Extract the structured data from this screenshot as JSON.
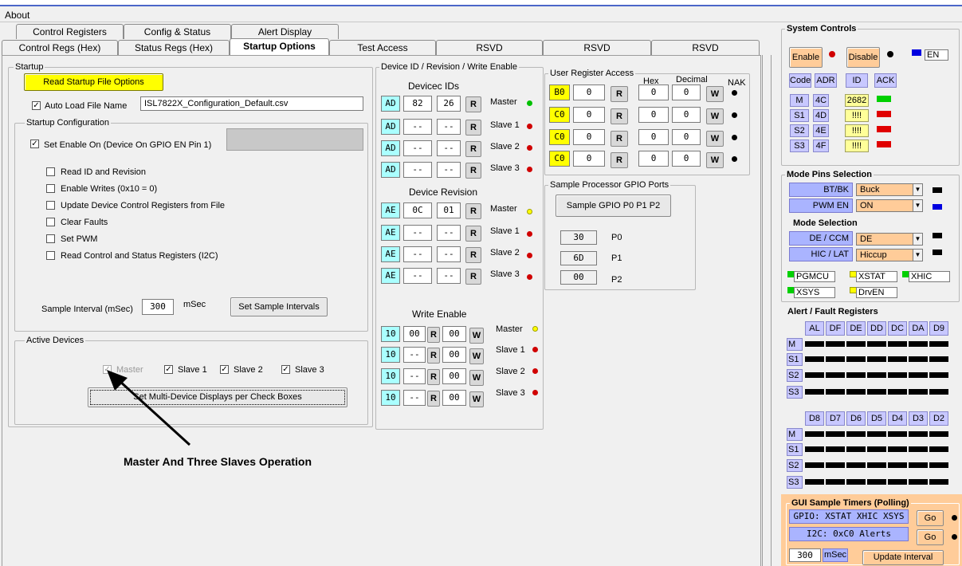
{
  "menu": {
    "about": "About"
  },
  "tabs_row1": [
    "Control Registers",
    "Config & Status",
    "Alert Display"
  ],
  "tabs_row2": [
    "Control Regs (Hex)",
    "Status Regs (Hex)",
    "Startup Options",
    "Test Access",
    "RSVD",
    "RSVD",
    "RSVD"
  ],
  "startup": {
    "title": "Startup",
    "read_btn": "Read Startup File Options",
    "auto_load": "Auto Load File Name",
    "file_name": "ISL7822X_Configuration_Default.csv",
    "config_title": "Startup Configuration",
    "set_enable": "Set Enable On (Device On GPIO  EN Pin 1)",
    "options": [
      "Read ID and Revision",
      "Enable Writes (0x10 = 0)",
      "Update Device Control Registers from File",
      "Clear Faults",
      "Set PWM",
      "Read Control and Status Registers (I2C)"
    ],
    "sample_label": "Sample Interval (mSec)",
    "sample_value": "300",
    "msec": "mSec",
    "set_sample_btn": "Set Sample Intervals",
    "active_title": "Active Devices",
    "active": [
      "Master",
      "Slave 1",
      "Slave 2",
      "Slave 3"
    ],
    "multi_btn": "Set Multi-Device Displays per Check Boxes"
  },
  "annotation": "Master And Three Slaves Operation",
  "device": {
    "title": "Device ID / Revision / Write Enable",
    "ids_title": "Devicec IDs",
    "rev_title": "Device Revision",
    "we_title": "Write Enable",
    "labels": [
      "Master",
      "Slave 1",
      "Slave 2",
      "Slave 3"
    ],
    "ids": [
      [
        "AD",
        "82",
        "26"
      ],
      [
        "AD",
        "--",
        "--"
      ],
      [
        "AD",
        "--",
        "--"
      ],
      [
        "AD",
        "--",
        "--"
      ]
    ],
    "revs": [
      [
        "AE",
        "0C",
        "01"
      ],
      [
        "AE",
        "--",
        "--"
      ],
      [
        "AE",
        "--",
        "--"
      ],
      [
        "AE",
        "--",
        "--"
      ]
    ],
    "we": [
      [
        "10",
        "00",
        "00"
      ],
      [
        "10",
        "--",
        "00"
      ],
      [
        "10",
        "--",
        "00"
      ],
      [
        "10",
        "--",
        "00"
      ]
    ],
    "r": "R",
    "w": "W"
  },
  "user_reg": {
    "title": "User Register Access",
    "hex": "Hex",
    "decimal": "Decimal",
    "nak": "NAK",
    "rows": [
      [
        "B0",
        "0",
        "0",
        "0"
      ],
      [
        "C0",
        "0",
        "0",
        "0"
      ],
      [
        "C0",
        "0",
        "0",
        "0"
      ],
      [
        "C0",
        "0",
        "0",
        "0"
      ]
    ]
  },
  "gpio": {
    "title": "Sample Processor GPIO Ports",
    "btn": "Sample GPIO P0  P1 P2",
    "ports": [
      [
        "30",
        "P0"
      ],
      [
        "6D",
        "P1"
      ],
      [
        "00",
        "P2"
      ]
    ]
  },
  "system": {
    "title": "System Controls",
    "enable": "Enable",
    "disable": "Disable",
    "en": "EN",
    "hdr": [
      "Code",
      "ADR",
      "ID",
      "ACK"
    ],
    "rows": [
      [
        "M",
        "4C",
        "2682"
      ],
      [
        "S1",
        "4D",
        "!!!!"
      ],
      [
        "S2",
        "4E",
        "!!!!"
      ],
      [
        "S3",
        "4F",
        "!!!!"
      ]
    ]
  },
  "mode": {
    "title": "Mode Pins Selection",
    "btbk": "BT/BK",
    "btbk_val": "Buck",
    "pwmen": "PWM EN",
    "pwmen_val": "ON",
    "mode_sel": "Mode Selection",
    "deccm": "DE / CCM",
    "deccm_val": "DE",
    "hiclat": "HIC / LAT",
    "hiclat_val": "Hiccup",
    "flags": [
      "PGMCU",
      "XSTAT",
      "XHIC",
      "XSYS",
      "DrvEN"
    ]
  },
  "alert": {
    "title": "Alert /  Fault Registers",
    "cols1": [
      "AL",
      "DF",
      "DE",
      "DD",
      "DC",
      "DA",
      "D9"
    ],
    "cols2": [
      "D8",
      "D7",
      "D6",
      "D5",
      "D4",
      "D3",
      "D2"
    ],
    "rows": [
      "M",
      "S1",
      "S2",
      "S3"
    ]
  },
  "timers": {
    "title": "GUI Sample Timers (Polling)",
    "gpio": "GPIO: XSTAT XHIC XSYS",
    "i2c": "I2C: 0xC0 Alerts",
    "go": "Go",
    "interval": "300",
    "msec": "mSec",
    "update": "Update Interval"
  },
  "colors": {
    "accent_blue": "#aab4ff",
    "orange": "#ffcc99",
    "yellow": "#ffff00",
    "cyan": "#aaffff",
    "red": "#e00000",
    "green": "#00d000"
  }
}
